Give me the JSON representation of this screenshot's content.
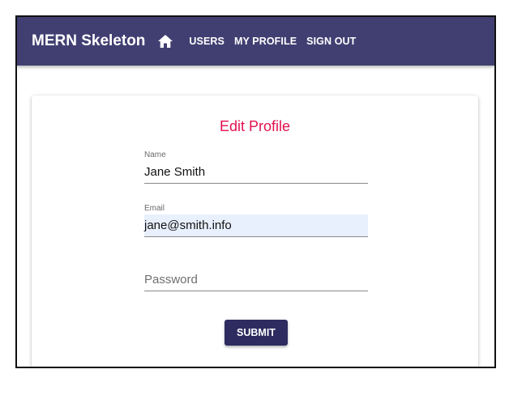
{
  "appbar": {
    "brand": "MERN Skeleton",
    "home_icon": "home-icon",
    "nav": [
      "USERS",
      "MY PROFILE",
      "SIGN OUT"
    ]
  },
  "card": {
    "title": "Edit Profile",
    "name_label": "Name",
    "name_value": "Jane Smith",
    "email_label": "Email",
    "email_value": "jane@smith.info",
    "password_placeholder": "Password",
    "submit_label": "SUBMIT"
  },
  "colors": {
    "appbar": "#413f72",
    "title": "#e3104f",
    "submit": "#2d2b5f",
    "autofill": "#e8f0fe"
  }
}
